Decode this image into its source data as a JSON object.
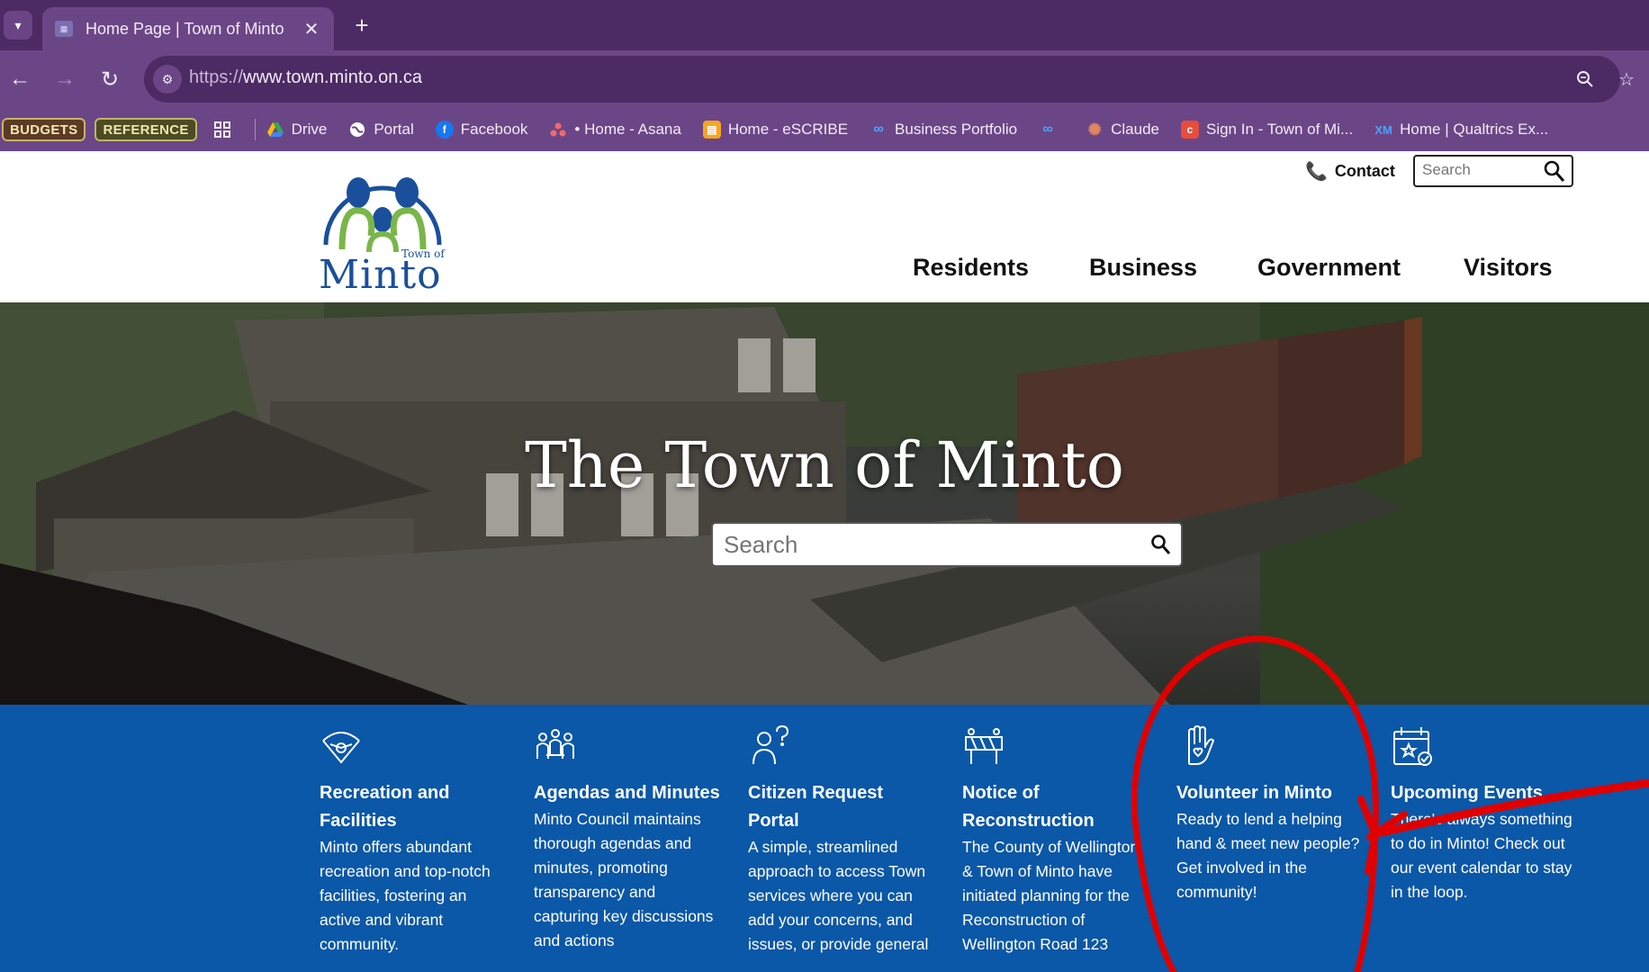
{
  "browser": {
    "tab_title": "Home Page | Town of Minto",
    "tab_close": "✕",
    "new_tab": "+",
    "url_scheme": "https://",
    "url_host": "www.town.minto.on.ca",
    "bookmarks": {
      "chips": [
        "BUDGETS",
        "REFERENCE"
      ],
      "items": [
        {
          "label": "Drive",
          "icon": "drive-icon",
          "color": "#fbbc04"
        },
        {
          "label": "Portal",
          "icon": "globe-icon",
          "color": "#ffffff"
        },
        {
          "label": "Facebook",
          "icon": "facebook-icon",
          "color": "#1877f2"
        },
        {
          "label": "• Home - Asana",
          "icon": "asana-icon",
          "color": "#f06a6a"
        },
        {
          "label": "Home - eSCRIBE",
          "icon": "escribe-icon",
          "color": "#f5a623"
        },
        {
          "label": "Business Portfolio",
          "icon": "meta-icon",
          "color": "#1877f2"
        },
        {
          "label": "",
          "icon": "meta-icon",
          "color": "#1877f2"
        },
        {
          "label": "Claude",
          "icon": "claude-icon",
          "color": "#d97757"
        },
        {
          "label": "Sign In - Town of Mi...",
          "icon": "signin-icon",
          "color": "#e74c3c"
        },
        {
          "label": "Home | Qualtrics Ex...",
          "icon": "qualtrics-icon",
          "color": "#2b6cff"
        }
      ]
    }
  },
  "header": {
    "logo_small": "Town of",
    "logo_big": "Minto",
    "contact_label": "Contact",
    "search_placeholder": "Search",
    "nav": [
      "Residents",
      "Business",
      "Government",
      "Visitors"
    ]
  },
  "hero": {
    "title": "The Town of Minto",
    "search_placeholder": "Search"
  },
  "quick_links": [
    {
      "title": "Recreation and Facilities",
      "desc": "Minto offers abundant recreation and top-notch facilities, fostering an active and vibrant community.",
      "icon": "recreation-icon"
    },
    {
      "title": "Agendas and Minutes",
      "desc": "Minto Council maintains thorough agendas and minutes, promoting transparency and capturing key discussions and actions",
      "icon": "meeting-icon"
    },
    {
      "title": "Citizen Request Portal",
      "desc": "A simple, streamlined approach to access Town services where you can add your concerns, and issues, or provide general",
      "icon": "citizen-question-icon"
    },
    {
      "title": "Notice of Reconstruction",
      "desc": "The County of Wellington & Town of Minto have initiated planning for the Reconstruction of Wellington Road 123",
      "icon": "road-barrier-icon"
    },
    {
      "title": "Volunteer in Minto",
      "desc": "Ready to lend a helping hand & meet new people? Get involved in the community!",
      "icon": "helping-hand-icon"
    },
    {
      "title": "Upcoming Events",
      "desc": "There's always something to do in Minto! Check out our event calendar to stay in the loop.",
      "icon": "calendar-star-icon"
    }
  ],
  "colors": {
    "chrome_dark": "#4c2a63",
    "chrome": "#6b4686",
    "quicklinks_bg": "#0b57a8",
    "logo_blue": "#1a4f9c",
    "logo_green": "#7ab648",
    "annotation_red": "#e00000"
  }
}
